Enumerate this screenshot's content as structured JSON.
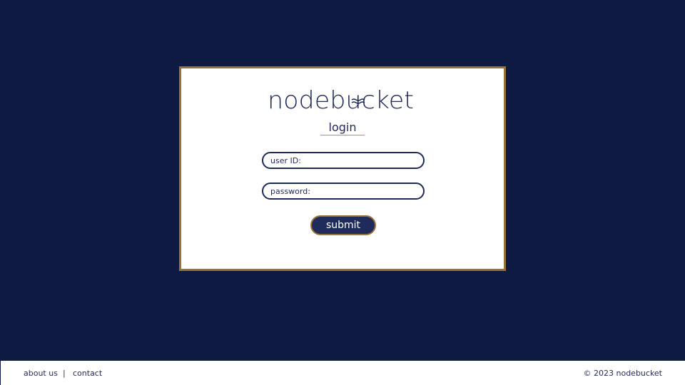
{
  "logo": {
    "text": "nodebucket"
  },
  "login": {
    "title": "login",
    "user_placeholder": "user ID:",
    "password_placeholder": "password:",
    "submit_label": "submit"
  },
  "footer": {
    "about_label": "about us",
    "separator": "|",
    "contact_label": "contact",
    "copyright": "© 2023 nodebucket"
  },
  "colors": {
    "background": "#0e1a42",
    "navy": "#1e2a55",
    "gold_border": "#9a7437"
  }
}
